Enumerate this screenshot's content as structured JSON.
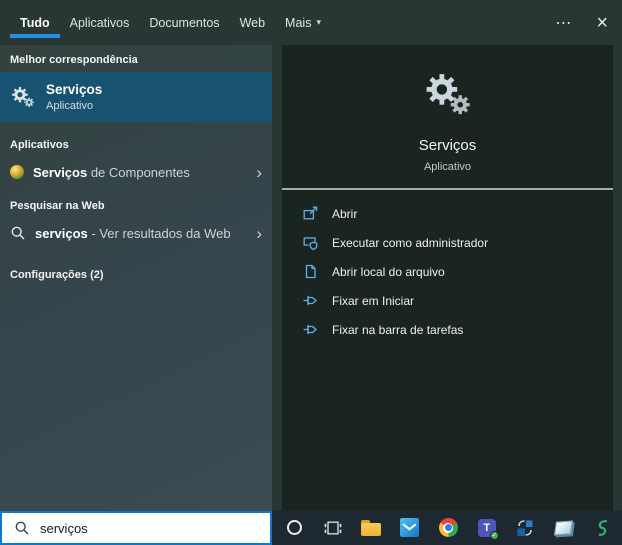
{
  "colors": {
    "accent_underline": "#1f8fe8",
    "best_match_highlight": "#175271",
    "action_icon_blue": "#5fb2e8",
    "search_border": "#0b79cf",
    "right_panel_bg": "#1a2420",
    "left_panel_bg": "#36454b",
    "taskbar_bg": "#1d2831"
  },
  "icons": {
    "more_options": "⋯",
    "close": "×",
    "dropdown_arrow": "▾",
    "chevron_right": "›",
    "teams_letter": "T",
    "teams_check": "✓"
  },
  "topbar": {
    "tabs": [
      {
        "label": "Tudo",
        "active": true
      },
      {
        "label": "Aplicativos",
        "active": false
      },
      {
        "label": "Documentos",
        "active": false
      },
      {
        "label": "Web",
        "active": false
      },
      {
        "label": "Mais",
        "active": false,
        "has_dropdown": true
      }
    ]
  },
  "left_panel": {
    "best_match": {
      "header": "Melhor correspondência",
      "item": {
        "icon": "gears-icon",
        "title": "Serviços",
        "subtitle": "Aplicativo"
      }
    },
    "apps": {
      "header": "Aplicativos",
      "item": {
        "icon": "component-services-icon",
        "bold": "Serviços",
        "rest": " de Componentes"
      }
    },
    "web": {
      "header": "Pesquisar na Web",
      "item": {
        "icon": "search-icon",
        "bold": "serviços",
        "rest": " - Ver resultados da Web"
      }
    },
    "settings": {
      "header": "Configurações (2)"
    }
  },
  "preview": {
    "icon": "gears-icon",
    "title": "Serviços",
    "subtitle": "Aplicativo",
    "actions": [
      {
        "icon": "open-icon",
        "label": "Abrir"
      },
      {
        "icon": "admin-shield-icon",
        "label": "Executar como administrador"
      },
      {
        "icon": "file-location-icon",
        "label": "Abrir local do arquivo"
      },
      {
        "icon": "pin-start-icon",
        "label": "Fixar em Iniciar"
      },
      {
        "icon": "pin-taskbar-icon",
        "label": "Fixar na barra de tarefas"
      }
    ]
  },
  "search": {
    "value": "serviços"
  },
  "taskbar": {
    "icons": [
      "cortana-icon",
      "task-view-icon",
      "file-explorer-icon",
      "mail-icon",
      "chrome-icon",
      "teams-icon",
      "sync-app-icon",
      "notepad-icon",
      "s-app-icon"
    ]
  }
}
